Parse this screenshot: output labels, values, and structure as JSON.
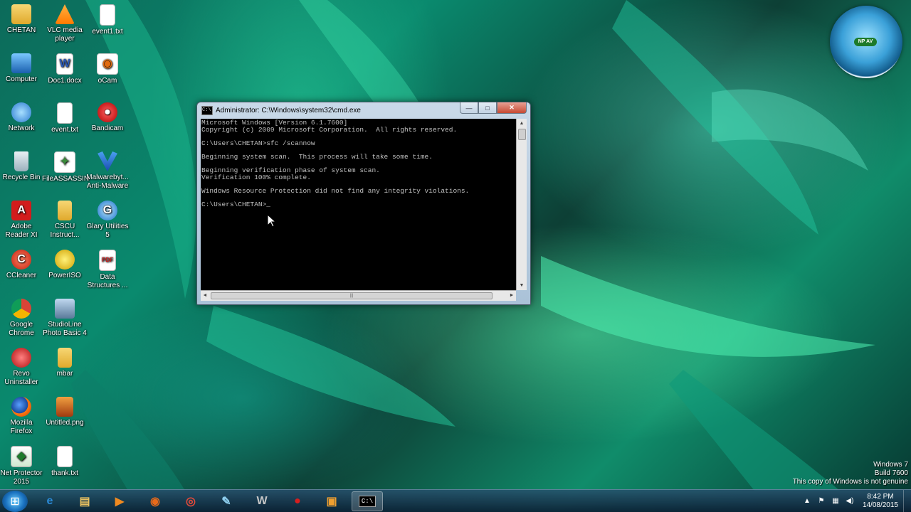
{
  "desktop": {
    "icons": [
      {
        "label": "CHETAN",
        "glyph": "folder-icon"
      },
      {
        "label": "VLC media player",
        "glyph": "vlc-icon"
      },
      {
        "label": "event1.txt",
        "glyph": "text-file-icon"
      },
      {
        "label": "Computer",
        "glyph": "computer-icon"
      },
      {
        "label": "Doc1.docx",
        "glyph": "word-doc-icon"
      },
      {
        "label": "oCam",
        "glyph": "ocam-icon"
      },
      {
        "label": "Network",
        "glyph": "network-icon"
      },
      {
        "label": "event.txt",
        "glyph": "text-file-icon"
      },
      {
        "label": "Bandicam",
        "glyph": "bandicam-icon"
      },
      {
        "label": "Recycle Bin",
        "glyph": "recycle-bin-icon"
      },
      {
        "label": "FileASSASSIN",
        "glyph": "fileassassin-icon"
      },
      {
        "label": "Malwarebyt... Anti-Malware",
        "glyph": "malwarebytes-icon"
      },
      {
        "label": "Adobe Reader XI",
        "glyph": "adobe-reader-icon"
      },
      {
        "label": "CSCU Instruct...",
        "glyph": "folder-icon"
      },
      {
        "label": "Glary Utilities 5",
        "glyph": "glary-icon"
      },
      {
        "label": "CCleaner",
        "glyph": "ccleaner-icon"
      },
      {
        "label": "PowerISO",
        "glyph": "poweriso-icon"
      },
      {
        "label": "Data Structures ...",
        "glyph": "pdf-icon"
      },
      {
        "label": "Google Chrome",
        "glyph": "chrome-icon"
      },
      {
        "label": "StudioLine Photo Basic 4",
        "glyph": "studioline-icon"
      },
      {
        "label": "Revo Uninstaller",
        "glyph": "revo-icon"
      },
      {
        "label": "mbar",
        "glyph": "folder-icon"
      },
      {
        "label": "Mozilla Firefox",
        "glyph": "firefox-icon"
      },
      {
        "label": "Untitled.png",
        "glyph": "image-file-icon"
      },
      {
        "label": "Net Protector 2015",
        "glyph": "net-protector-icon"
      },
      {
        "label": "thank.txt",
        "glyph": "text-file-icon"
      }
    ]
  },
  "cmd": {
    "title": "Administrator: C:\\Windows\\system32\\cmd.exe",
    "icon_text": "C:\\",
    "min_label": "—",
    "max_label": "□",
    "close_label": "✕",
    "lines": [
      "Microsoft Windows [Version 6.1.7600]",
      "Copyright (c) 2009 Microsoft Corporation.  All rights reserved.",
      "",
      "C:\\Users\\CHETAN>sfc /scannow",
      "",
      "Beginning system scan.  This process will take some time.",
      "",
      "Beginning verification phase of system scan.",
      "Verification 100% complete.",
      "",
      "Windows Resource Protection did not find any integrity violations.",
      "",
      "C:\\Users\\CHETAN>_"
    ],
    "scroll_up": "▲",
    "scroll_down": "▼",
    "scroll_left": "◄",
    "scroll_right": "►",
    "hthumb_grip": "|||"
  },
  "gadget": {
    "badge": "NP AV"
  },
  "watermark": {
    "line1": "Windows 7",
    "line2": "Build 7600",
    "line3": "This copy of Windows is not genuine"
  },
  "taskbar": {
    "start_glyph": "⊞",
    "items": [
      {
        "name": "internet-explorer-icon",
        "glyph": "e",
        "color": "#2a8ad8"
      },
      {
        "name": "windows-explorer-icon",
        "glyph": "▤",
        "color": "#e8c060"
      },
      {
        "name": "media-player-icon",
        "glyph": "▶",
        "color": "#f08a20"
      },
      {
        "name": "firefox-icon",
        "glyph": "◉",
        "color": "#e86a1a"
      },
      {
        "name": "chrome-icon",
        "glyph": "◎",
        "color": "#e64a3a"
      },
      {
        "name": "notepad-icon",
        "glyph": "✎",
        "color": "#8fd0f0"
      },
      {
        "name": "wwe-game-icon",
        "glyph": "W",
        "color": "#c8c8c8"
      },
      {
        "name": "bandicam-icon",
        "glyph": "●",
        "color": "#d81e1e"
      },
      {
        "name": "ocam-icon",
        "glyph": "▣",
        "color": "#f0a030"
      },
      {
        "name": "cmd-icon",
        "glyph": "C:\\",
        "color": "#ffffff"
      }
    ],
    "tray": {
      "chevron": "▲",
      "flag": "⚑",
      "network": "▦",
      "volume": "◀)",
      "time": "8:42 PM",
      "date": "14/08/2015"
    }
  },
  "colors": {
    "console_bg": "#000000",
    "console_text": "#c0c0c0",
    "close_button": "#c74a33"
  }
}
